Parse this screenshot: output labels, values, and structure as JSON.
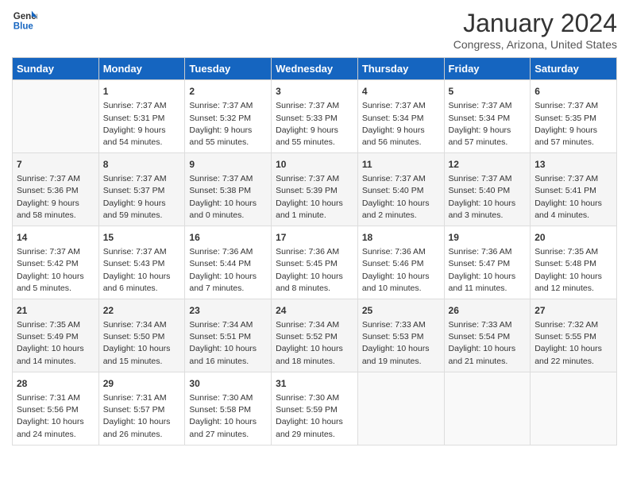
{
  "header": {
    "logo_line1": "General",
    "logo_line2": "Blue",
    "title": "January 2024",
    "subtitle": "Congress, Arizona, United States"
  },
  "days_of_week": [
    "Sunday",
    "Monday",
    "Tuesday",
    "Wednesday",
    "Thursday",
    "Friday",
    "Saturday"
  ],
  "weeks": [
    [
      {
        "num": "",
        "info": ""
      },
      {
        "num": "1",
        "info": "Sunrise: 7:37 AM\nSunset: 5:31 PM\nDaylight: 9 hours\nand 54 minutes."
      },
      {
        "num": "2",
        "info": "Sunrise: 7:37 AM\nSunset: 5:32 PM\nDaylight: 9 hours\nand 55 minutes."
      },
      {
        "num": "3",
        "info": "Sunrise: 7:37 AM\nSunset: 5:33 PM\nDaylight: 9 hours\nand 55 minutes."
      },
      {
        "num": "4",
        "info": "Sunrise: 7:37 AM\nSunset: 5:34 PM\nDaylight: 9 hours\nand 56 minutes."
      },
      {
        "num": "5",
        "info": "Sunrise: 7:37 AM\nSunset: 5:34 PM\nDaylight: 9 hours\nand 57 minutes."
      },
      {
        "num": "6",
        "info": "Sunrise: 7:37 AM\nSunset: 5:35 PM\nDaylight: 9 hours\nand 57 minutes."
      }
    ],
    [
      {
        "num": "7",
        "info": "Sunrise: 7:37 AM\nSunset: 5:36 PM\nDaylight: 9 hours\nand 58 minutes."
      },
      {
        "num": "8",
        "info": "Sunrise: 7:37 AM\nSunset: 5:37 PM\nDaylight: 9 hours\nand 59 minutes."
      },
      {
        "num": "9",
        "info": "Sunrise: 7:37 AM\nSunset: 5:38 PM\nDaylight: 10 hours\nand 0 minutes."
      },
      {
        "num": "10",
        "info": "Sunrise: 7:37 AM\nSunset: 5:39 PM\nDaylight: 10 hours\nand 1 minute."
      },
      {
        "num": "11",
        "info": "Sunrise: 7:37 AM\nSunset: 5:40 PM\nDaylight: 10 hours\nand 2 minutes."
      },
      {
        "num": "12",
        "info": "Sunrise: 7:37 AM\nSunset: 5:40 PM\nDaylight: 10 hours\nand 3 minutes."
      },
      {
        "num": "13",
        "info": "Sunrise: 7:37 AM\nSunset: 5:41 PM\nDaylight: 10 hours\nand 4 minutes."
      }
    ],
    [
      {
        "num": "14",
        "info": "Sunrise: 7:37 AM\nSunset: 5:42 PM\nDaylight: 10 hours\nand 5 minutes."
      },
      {
        "num": "15",
        "info": "Sunrise: 7:37 AM\nSunset: 5:43 PM\nDaylight: 10 hours\nand 6 minutes."
      },
      {
        "num": "16",
        "info": "Sunrise: 7:36 AM\nSunset: 5:44 PM\nDaylight: 10 hours\nand 7 minutes."
      },
      {
        "num": "17",
        "info": "Sunrise: 7:36 AM\nSunset: 5:45 PM\nDaylight: 10 hours\nand 8 minutes."
      },
      {
        "num": "18",
        "info": "Sunrise: 7:36 AM\nSunset: 5:46 PM\nDaylight: 10 hours\nand 10 minutes."
      },
      {
        "num": "19",
        "info": "Sunrise: 7:36 AM\nSunset: 5:47 PM\nDaylight: 10 hours\nand 11 minutes."
      },
      {
        "num": "20",
        "info": "Sunrise: 7:35 AM\nSunset: 5:48 PM\nDaylight: 10 hours\nand 12 minutes."
      }
    ],
    [
      {
        "num": "21",
        "info": "Sunrise: 7:35 AM\nSunset: 5:49 PM\nDaylight: 10 hours\nand 14 minutes."
      },
      {
        "num": "22",
        "info": "Sunrise: 7:34 AM\nSunset: 5:50 PM\nDaylight: 10 hours\nand 15 minutes."
      },
      {
        "num": "23",
        "info": "Sunrise: 7:34 AM\nSunset: 5:51 PM\nDaylight: 10 hours\nand 16 minutes."
      },
      {
        "num": "24",
        "info": "Sunrise: 7:34 AM\nSunset: 5:52 PM\nDaylight: 10 hours\nand 18 minutes."
      },
      {
        "num": "25",
        "info": "Sunrise: 7:33 AM\nSunset: 5:53 PM\nDaylight: 10 hours\nand 19 minutes."
      },
      {
        "num": "26",
        "info": "Sunrise: 7:33 AM\nSunset: 5:54 PM\nDaylight: 10 hours\nand 21 minutes."
      },
      {
        "num": "27",
        "info": "Sunrise: 7:32 AM\nSunset: 5:55 PM\nDaylight: 10 hours\nand 22 minutes."
      }
    ],
    [
      {
        "num": "28",
        "info": "Sunrise: 7:31 AM\nSunset: 5:56 PM\nDaylight: 10 hours\nand 24 minutes."
      },
      {
        "num": "29",
        "info": "Sunrise: 7:31 AM\nSunset: 5:57 PM\nDaylight: 10 hours\nand 26 minutes."
      },
      {
        "num": "30",
        "info": "Sunrise: 7:30 AM\nSunset: 5:58 PM\nDaylight: 10 hours\nand 27 minutes."
      },
      {
        "num": "31",
        "info": "Sunrise: 7:30 AM\nSunset: 5:59 PM\nDaylight: 10 hours\nand 29 minutes."
      },
      {
        "num": "",
        "info": ""
      },
      {
        "num": "",
        "info": ""
      },
      {
        "num": "",
        "info": ""
      }
    ]
  ]
}
